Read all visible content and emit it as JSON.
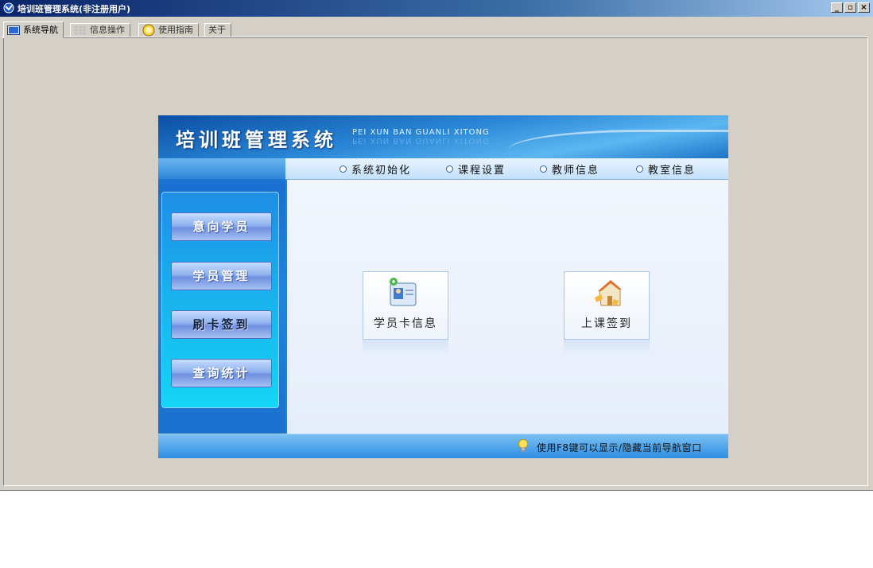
{
  "window": {
    "title": "培训班管理系统(非注册用户)"
  },
  "tabs": [
    {
      "label": "系统导航",
      "icon": "monitor-icon"
    },
    {
      "label": "信息操作",
      "icon": "grid-icon"
    },
    {
      "label": "使用指南",
      "icon": "help-icon"
    },
    {
      "label": "关于",
      "icon": ""
    }
  ],
  "banner": {
    "title": "培训班管理系统",
    "subtitle": "PEI XUN BAN GUANLI XITONG"
  },
  "topmenu": [
    {
      "label": "系统初始化"
    },
    {
      "label": "课程设置"
    },
    {
      "label": "教师信息"
    },
    {
      "label": "教室信息"
    }
  ],
  "sidenav": [
    {
      "label": "意向学员"
    },
    {
      "label": "学员管理"
    },
    {
      "label": "刷卡签到"
    },
    {
      "label": "查询统计"
    }
  ],
  "tiles": [
    {
      "label": "学员卡信息",
      "icon": "student-card-icon"
    },
    {
      "label": "上课签到",
      "icon": "checkin-house-icon"
    }
  ],
  "status": {
    "tip": "使用F8键可以显示/隐藏当前导航窗口"
  },
  "colors": {
    "titlebar": "#0a246a",
    "banner": "#1e73c8",
    "nav": "#14d6f4",
    "face": "#d4d0c8"
  }
}
